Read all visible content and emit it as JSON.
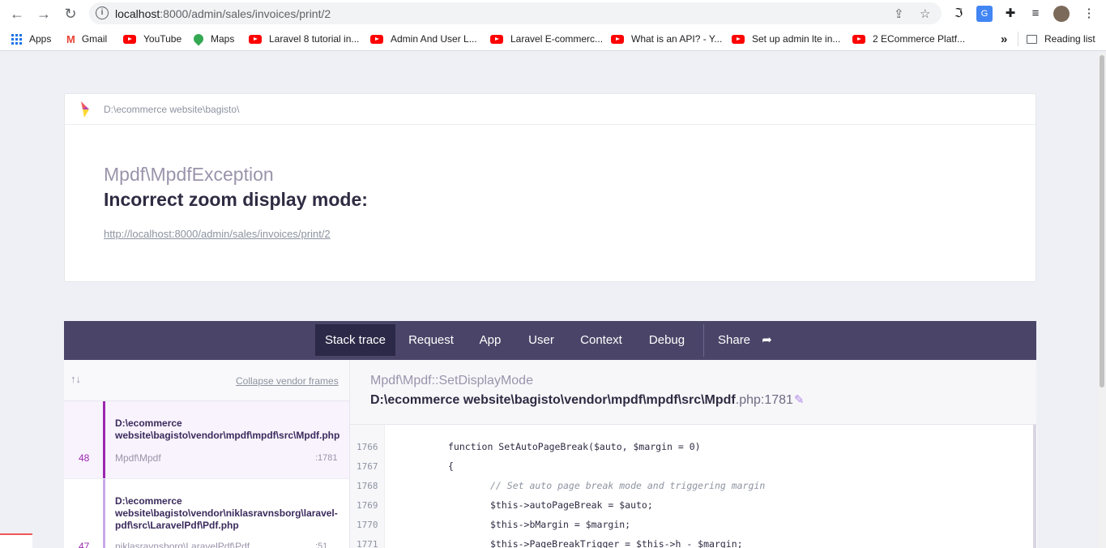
{
  "browser": {
    "url_host": "localhost",
    "url_rest": ":8000/admin/sales/invoices/print/2",
    "bookmarks": [
      {
        "label": "Apps",
        "icon": "apps-grid-icon"
      },
      {
        "label": "Gmail",
        "icon": "gmail-icon"
      },
      {
        "label": "YouTube",
        "icon": "youtube-icon"
      },
      {
        "label": "Maps",
        "icon": "maps-icon"
      },
      {
        "label": "Laravel 8 tutorial in...",
        "icon": "youtube-icon"
      },
      {
        "label": "Admin And User L...",
        "icon": "youtube-icon"
      },
      {
        "label": "Laravel E-commerc...",
        "icon": "youtube-icon"
      },
      {
        "label": "What is an API? - Y...",
        "icon": "youtube-icon"
      },
      {
        "label": "Set up admin lte in...",
        "icon": "youtube-icon"
      },
      {
        "label": "2 ECommerce Platf...",
        "icon": "youtube-icon"
      }
    ],
    "overflow": "»",
    "reading_list": "Reading list"
  },
  "error": {
    "app_path": "D:\\ecommerce website\\bagisto\\",
    "exception_class": "Mpdf\\MpdfException",
    "message": "Incorrect zoom display mode:",
    "request_url": "http://localhost:8000/admin/sales/invoices/print/2"
  },
  "tabs": [
    {
      "label": "Stack trace",
      "active": true
    },
    {
      "label": "Request"
    },
    {
      "label": "App"
    },
    {
      "label": "User"
    },
    {
      "label": "Context"
    },
    {
      "label": "Debug"
    },
    {
      "label": "Share"
    }
  ],
  "frames_panel": {
    "arrows": "↑↓",
    "collapse_label": "Collapse vendor frames",
    "frames": [
      {
        "number": "48",
        "file": "D:\\ecommerce website\\bagisto\\vendor\\mpdf\\mpdf\\src\\Mpdf.php",
        "class": "Mpdf\\Mpdf",
        "line": ":1781"
      },
      {
        "number": "47",
        "file": "D:\\ecommerce website\\bagisto\\vendor\\niklasravnsborg\\laravel-pdf\\src\\LaravelPdf\\Pdf.php",
        "class": "niklasravnsborg\\LaravelPdf\\Pdf",
        "line": ":51"
      }
    ]
  },
  "detail": {
    "method": "Mpdf\\Mpdf::SetDisplayMode",
    "file": "D:\\ecommerce website\\bagisto\\vendor\\mpdf\\mpdf\\src\\Mpdf",
    "file_ext_line": ".php:1781",
    "code_lines": [
      {
        "n": "1766",
        "c": "function SetAutoPageBreak($auto, $margin = 0)"
      },
      {
        "n": "1767",
        "c": "{"
      },
      {
        "n": "1768",
        "c": "// Set auto page break mode and triggering margin"
      },
      {
        "n": "1769",
        "c": "$this->autoPageBreak = $auto;"
      },
      {
        "n": "1770",
        "c": "$this->bMargin = $margin;"
      },
      {
        "n": "1771",
        "c": "$this->PageBreakTrigger = $this->h - $margin;"
      }
    ]
  }
}
